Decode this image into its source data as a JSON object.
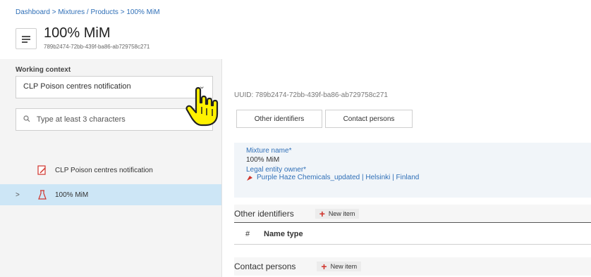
{
  "breadcrumb": {
    "dashboard": "Dashboard",
    "sep1": " > ",
    "mixtures": "Mixtures / Products",
    "sep2": " > ",
    "current": "100% MiM"
  },
  "header": {
    "title": "100% MiM",
    "subtitle": "789b2474-72bb-439f-ba86-ab729758c271"
  },
  "sidebar": {
    "context_label": "Working context",
    "context_value": "CLP Poison centres notification",
    "search_placeholder": "Type at least 3 characters",
    "tree": [
      {
        "label": "CLP Poison centres notification"
      },
      {
        "label": "100% MiM",
        "toggle": ">"
      }
    ]
  },
  "main": {
    "uuid": "UUID: 789b2474-72bb-439f-ba86-ab729758c271",
    "buttons": {
      "other_identifiers": "Other identifiers",
      "contact_persons": "Contact persons"
    },
    "mixture_name_label": "Mixture name*",
    "mixture_name_value": "100% MiM",
    "legal_entity_label": "Legal entity owner*",
    "legal_entity_value": "Purple Haze Chemicals_updated | Helsinki | Finland",
    "sections": {
      "other_identifiers": "Other identifiers",
      "contact_persons": "Contact persons",
      "new_item": "New item"
    },
    "table": {
      "col_hash": "#",
      "col_name_type": "Name type"
    }
  },
  "colors": {
    "accent_blue": "#2f6fb7",
    "selected_row": "#cde6f6",
    "new_item_plus": "#d0342c"
  }
}
